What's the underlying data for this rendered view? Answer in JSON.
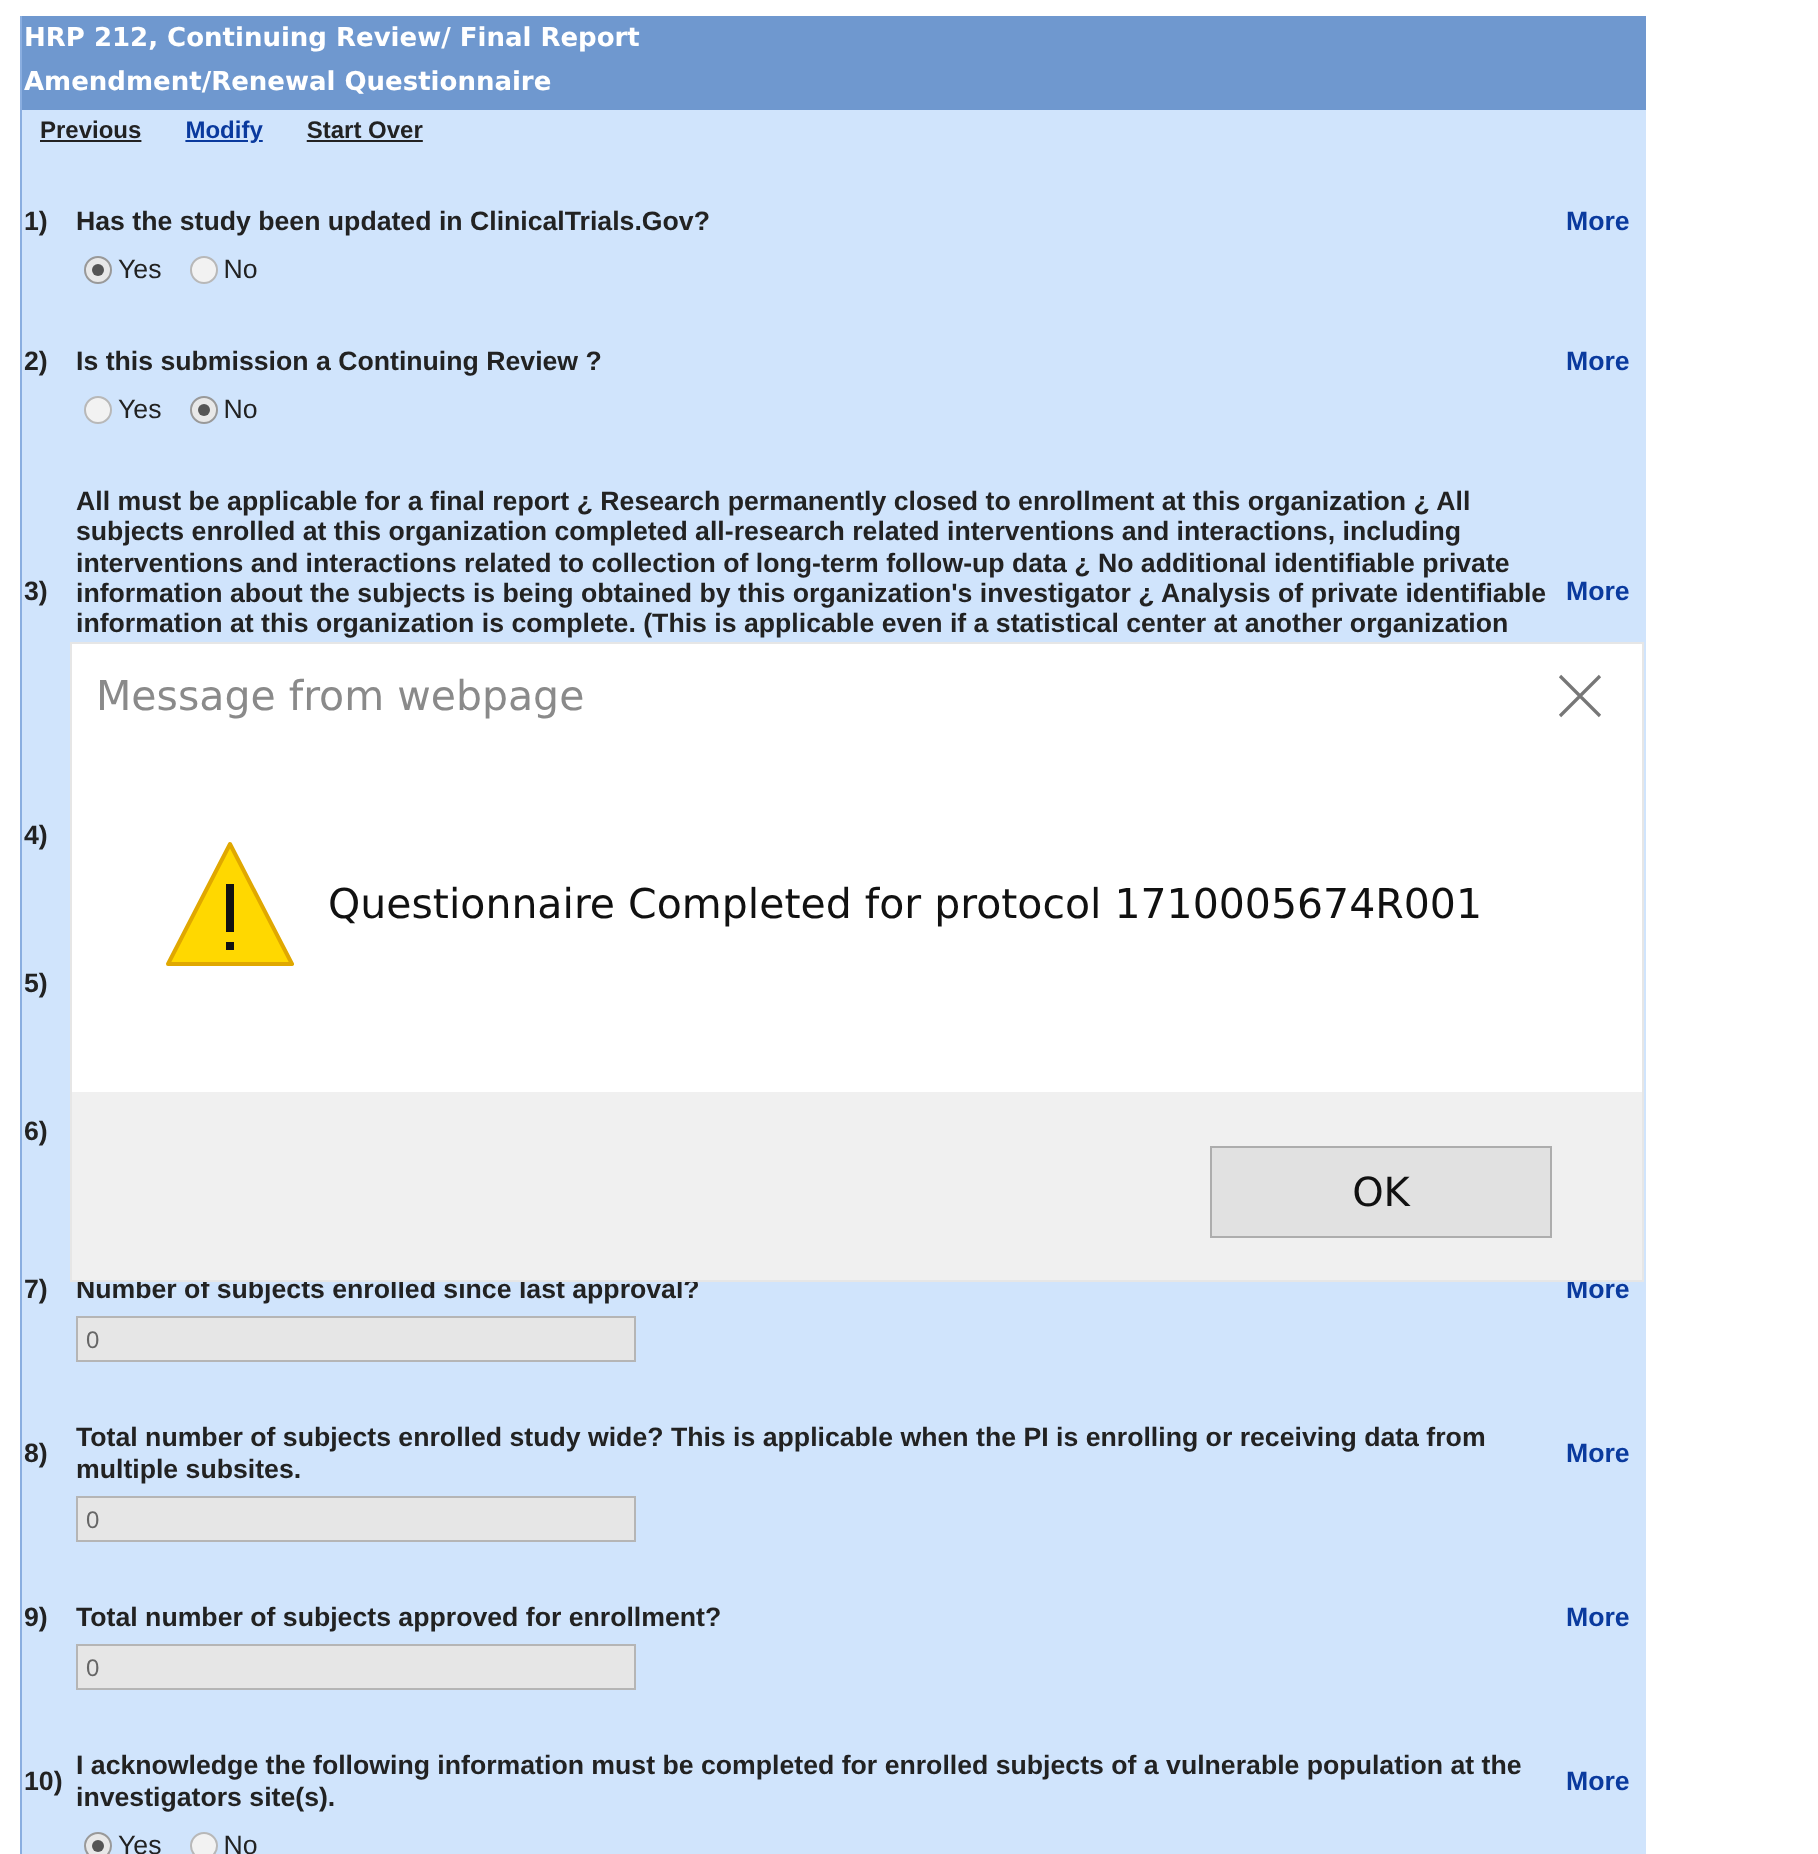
{
  "header": {
    "title_lines": [
      "HRP 212, Continuing Review/ Final Report",
      "Amendment/Renewal Questionnaire"
    ]
  },
  "nav_links": [
    {
      "label": "Previous",
      "selected": false
    },
    {
      "label": "Modify",
      "selected": true
    },
    {
      "label": "Start Over",
      "selected": false
    }
  ],
  "questions": [
    {
      "kind": "radio",
      "number": "1)",
      "text": "Has the study been updated in ClinicalTrials.Gov?",
      "more": "More",
      "options": [
        {
          "label": "Yes",
          "selected": true
        },
        {
          "label": "No",
          "selected": false
        }
      ]
    },
    {
      "kind": "radio",
      "number": "2)",
      "text": "Is this submission a Continuing Review ?",
      "more": "More",
      "options": [
        {
          "label": "Yes",
          "selected": false
        },
        {
          "label": "No",
          "selected": true
        }
      ]
    },
    {
      "kind": "text",
      "number": "3)",
      "text": "All must be applicable for a final report ¿ Research permanently closed to enrollment at this organization ¿ All subjects enrolled at this organization completed all-research related interventions and interactions, including interventions and interactions related to collection of long-term follow-up data ¿ No additional identifiable private information about the subjects is being obtained by this organization's investigator ¿ Analysis of private identifiable information at this organization is complete. (This is applicable even if a statistical center at another organization",
      "more": "More"
    },
    {
      "kind": "covered",
      "number": "4)"
    },
    {
      "kind": "covered",
      "number": "5)"
    },
    {
      "kind": "covered",
      "number": "6)"
    },
    {
      "kind": "input",
      "number": "7)",
      "text": "Number of subjects enrolled since last approval?",
      "more": "More",
      "value": "0"
    },
    {
      "kind": "input",
      "number": "8)",
      "text": "Total number of subjects enrolled study wide? This is applicable when the PI is enrolling or receiving data from multiple subsites.",
      "more": "More",
      "value": "0"
    },
    {
      "kind": "input",
      "number": "9)",
      "text": "Total number of subjects approved for enrollment?",
      "more": "More",
      "value": "0"
    },
    {
      "kind": "radio",
      "number": "10)",
      "text": "I acknowledge the following information must be completed for enrolled subjects of a vulnerable population at the investigators site(s).",
      "more": "More",
      "options": [
        {
          "label": "Yes",
          "selected": true
        },
        {
          "label": "No",
          "selected": false
        }
      ]
    }
  ],
  "dialog": {
    "title": "Message from webpage",
    "message": "Questionnaire Completed for protocol 1710005674R001",
    "button": "OK"
  }
}
